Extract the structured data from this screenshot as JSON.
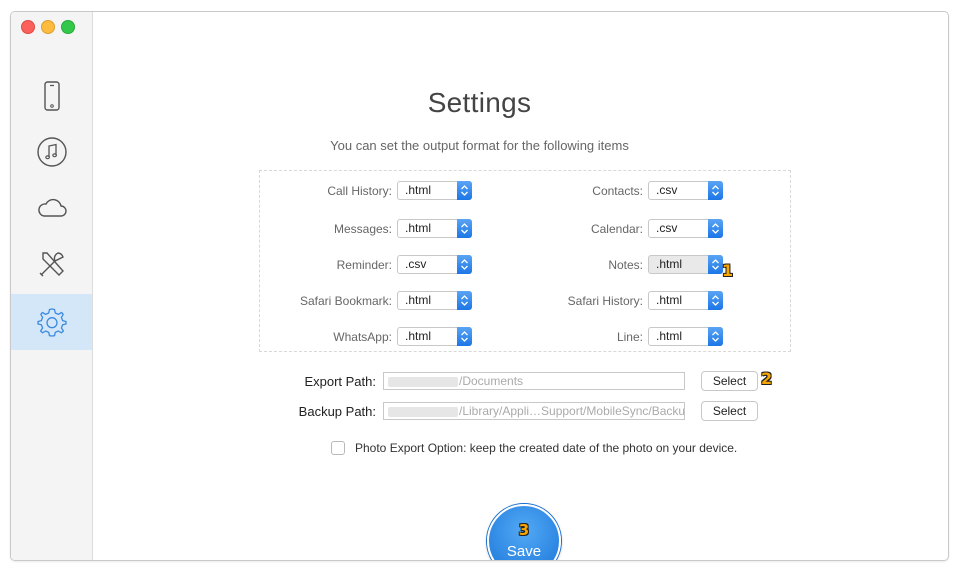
{
  "window": {
    "title": "Settings",
    "subtitle": "You can set the output format for the following items"
  },
  "sidebar": {
    "items": [
      {
        "name": "device",
        "icon": "phone-icon"
      },
      {
        "name": "music",
        "icon": "music-icon"
      },
      {
        "name": "icloud",
        "icon": "cloud-icon"
      },
      {
        "name": "tools",
        "icon": "tools-icon"
      },
      {
        "name": "settings",
        "icon": "gear-icon",
        "active": true
      }
    ]
  },
  "formats": {
    "left": [
      {
        "label": "Call History:",
        "value": ".html"
      },
      {
        "label": "Messages:",
        "value": ".html"
      },
      {
        "label": "Reminder:",
        "value": ".csv"
      },
      {
        "label": "Safari Bookmark:",
        "value": ".html"
      },
      {
        "label": "WhatsApp:",
        "value": ".html"
      }
    ],
    "right": [
      {
        "label": "Contacts:",
        "value": ".csv"
      },
      {
        "label": "Calendar:",
        "value": ".csv"
      },
      {
        "label": "Notes:",
        "value": ".html"
      },
      {
        "label": "Safari History:",
        "value": ".html"
      },
      {
        "label": "Line:",
        "value": ".html"
      }
    ]
  },
  "paths": {
    "export": {
      "label": "Export Path:",
      "value": "/Documents",
      "button": "Select"
    },
    "backup": {
      "label": "Backup Path:",
      "value": "/Library/Appli…Support/MobileSync/Backup",
      "button": "Select"
    }
  },
  "photo_option": {
    "label": "Photo Export Option: keep the created date of the photo on your device.",
    "checked": false
  },
  "save": {
    "label": "Save"
  },
  "annotations": {
    "step1": "1",
    "step2": "2",
    "step3": "3"
  },
  "colors": {
    "accent": "#1c76e6",
    "badge": "#f7a500",
    "sidebar_active": "#d4e7f8"
  }
}
